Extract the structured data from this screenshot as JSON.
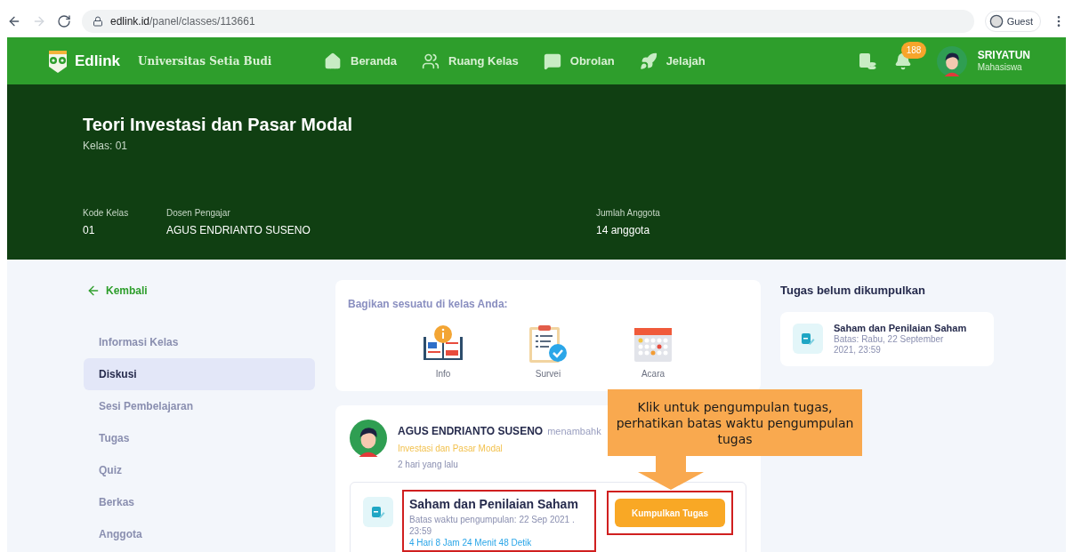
{
  "browser": {
    "url_host": "edlink.id",
    "url_path": "/panel/classes/113661",
    "profile": "Guest"
  },
  "header": {
    "brand": "Edlink",
    "institution": "Universitas Setia Budi",
    "nav": [
      {
        "label": "Beranda",
        "kind": "home"
      },
      {
        "label": "Ruang Kelas",
        "kind": "classroom"
      },
      {
        "label": "Obrolan",
        "kind": "chat"
      },
      {
        "label": "Jelajah",
        "kind": "explore"
      }
    ],
    "notification_count": "188",
    "user": {
      "name": "SRIYATUN",
      "role": "Mahasiswa"
    }
  },
  "class": {
    "title": "Teori Investasi dan Pasar Modal",
    "subtitle": "Kelas: 01",
    "info": [
      {
        "label": "Kode Kelas",
        "value": "01"
      },
      {
        "label": "Dosen Pengajar",
        "value": "AGUS ENDRIANTO SUSENO"
      },
      {
        "label": "Jumlah Anggota",
        "value": "14 anggota"
      }
    ]
  },
  "sidebar": {
    "back_link": "Kembali",
    "items": [
      {
        "label": "Informasi Kelas",
        "selected": false
      },
      {
        "label": "Diskusi",
        "selected": true
      },
      {
        "label": "Sesi Pembelajaran",
        "selected": false
      },
      {
        "label": "Tugas",
        "selected": false
      },
      {
        "label": "Quiz",
        "selected": false
      },
      {
        "label": "Berkas",
        "selected": false
      },
      {
        "label": "Anggota",
        "selected": false
      }
    ]
  },
  "share": {
    "prompt": "Bagikan sesuatu di kelas Anda:",
    "options": [
      {
        "label": "Info",
        "kind": "info"
      },
      {
        "label": "Survei",
        "kind": "survey"
      },
      {
        "label": "Acara",
        "kind": "event"
      }
    ]
  },
  "post": {
    "author": "AGUS ENDRIANTO SUSENO",
    "action": "menambahk",
    "course": "Investasi dan Pasar Modal",
    "time": "2 hari yang lalu",
    "assignment": {
      "title": "Saham dan Penilaian Saham",
      "deadline": "Batas waktu pengumpulan: 22 Sep 2021 . 23:59",
      "countdown": "4 Hari 8 Jam 24 Menit 48 Detik",
      "button": "Kumpulkan Tugas"
    }
  },
  "pending": {
    "title": "Tugas belum dikumpulkan",
    "items": [
      {
        "title": "Saham dan Penilaian Saham",
        "deadline": "Batas: Rabu, 22 September 2021, 23:59"
      }
    ]
  },
  "annotation": {
    "text": "Klik untuk pengumpulan tugas, perhatikan batas waktu pengumpulan tugas"
  }
}
